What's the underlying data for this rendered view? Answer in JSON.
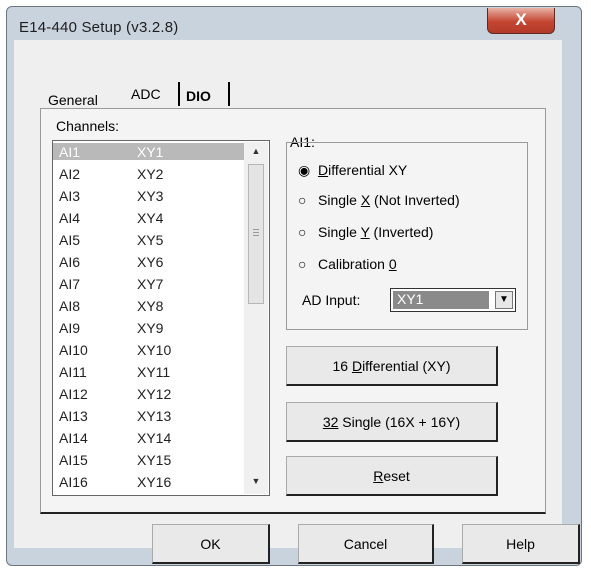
{
  "window": {
    "title": "E14-440 Setup (v3.2.8)",
    "close_glyph": "X"
  },
  "tabs": [
    {
      "label": "General"
    },
    {
      "label": "ADC"
    },
    {
      "label": "DIO"
    }
  ],
  "channels": {
    "label": "Channels:",
    "items": [
      {
        "ai": "AI1",
        "xy": "XY1",
        "selected": true
      },
      {
        "ai": "AI2",
        "xy": "XY2"
      },
      {
        "ai": "AI3",
        "xy": "XY3"
      },
      {
        "ai": "AI4",
        "xy": "XY4"
      },
      {
        "ai": "AI5",
        "xy": "XY5"
      },
      {
        "ai": "AI6",
        "xy": "XY6"
      },
      {
        "ai": "AI7",
        "xy": "XY7"
      },
      {
        "ai": "AI8",
        "xy": "XY8"
      },
      {
        "ai": "AI9",
        "xy": "XY9"
      },
      {
        "ai": "AI10",
        "xy": "XY10"
      },
      {
        "ai": "AI11",
        "xy": "XY11"
      },
      {
        "ai": "AI12",
        "xy": "XY12"
      },
      {
        "ai": "AI13",
        "xy": "XY13"
      },
      {
        "ai": "AI14",
        "xy": "XY14"
      },
      {
        "ai": "AI15",
        "xy": "XY15"
      },
      {
        "ai": "AI16",
        "xy": "XY16"
      }
    ]
  },
  "channel_settings": {
    "group_title": "AI1:",
    "options": [
      {
        "pre": "",
        "key": "D",
        "post": "ifferential XY",
        "checked": true
      },
      {
        "pre": "Single ",
        "key": "X",
        "post": " (Not Inverted)",
        "checked": false
      },
      {
        "pre": "Single ",
        "key": "Y",
        "post": " (Inverted)",
        "checked": false
      },
      {
        "pre": "Calibration ",
        "key": "0",
        "post": "",
        "checked": false
      }
    ],
    "ad_input_label": "AD Input:",
    "ad_input_value": "XY1"
  },
  "actions": {
    "diff_pre": "16 ",
    "diff_key": "D",
    "diff_post": "ifferential (XY)",
    "single_key": "32",
    "single_post": " Single (16X + 16Y)",
    "reset_key": "R",
    "reset_post": "eset"
  },
  "footer": {
    "ok": "OK",
    "cancel": "Cancel",
    "help": "Help"
  }
}
